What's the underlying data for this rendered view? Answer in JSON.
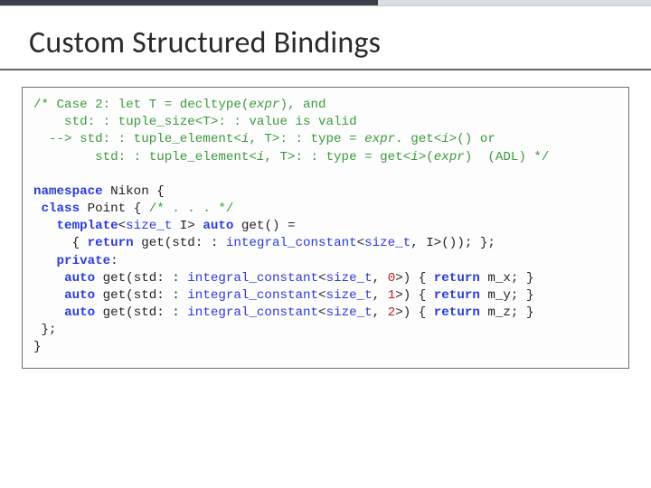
{
  "title": "Custom Structured Bindings",
  "code": {
    "c1a": "/* Case 2: let T = decltype(",
    "c1b": "expr",
    "c1c": "), and",
    "c2": "    std: : tuple_size<T>: : value is valid",
    "c3a": "  --> std: : tuple_element<",
    "c3b": "i",
    "c3c": ", T>: : type = ",
    "c3d": "expr",
    "c3e": ". get<",
    "c3f": "i",
    "c3g": ">() or",
    "c4a": "        std: : tuple_element<",
    "c4b": "i",
    "c4c": ", T>: : type = get<",
    "c4d": "i",
    "c4e": ">(",
    "c4f": "expr",
    "c4g": ")  (ADL) */",
    "kw_namespace": "namespace",
    "ns_name": " Nikon {",
    "kw_class": " class",
    "cls_name": " Point { ",
    "cls_cmt": "/* . . . */",
    "kw_template": "   template",
    "tpl_open": "<",
    "ty_size_t": "size_t",
    "tpl_rest": " I> ",
    "kw_auto": "auto",
    "get_decl": " get() =",
    "ret_open": "     { ",
    "kw_return": "return",
    "get_call_a": " get(std: : ",
    "ty_intconst": "integral_constant",
    "ic_open": "<",
    "ic_mid": ", I>()); };",
    "kw_private": "   private",
    "colon": ":",
    "auto_ln_a": "    ",
    "get_std": " get(std: : ",
    "ic_comma": ", ",
    "n0": "0",
    "n1": "1",
    "n2": "2",
    "ic_close": ">) { ",
    "mx": " m_x; }",
    "my": " m_y; }",
    "mz": " m_z; }",
    "cls_close": " };",
    "ns_close": "}"
  }
}
